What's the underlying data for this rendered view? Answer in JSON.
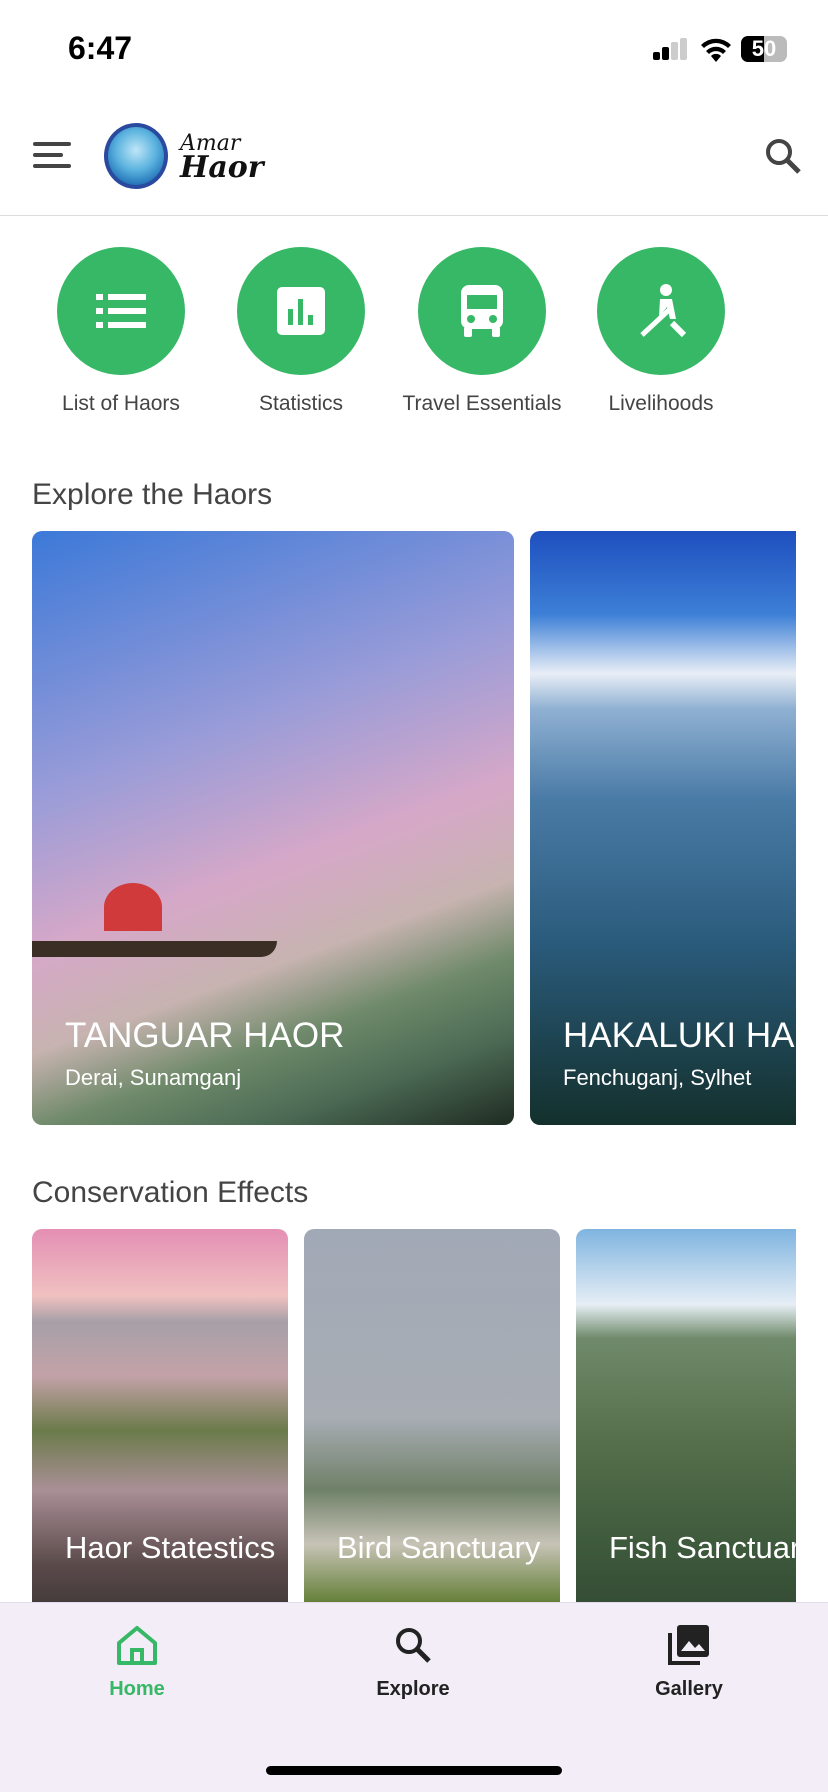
{
  "status_bar": {
    "time": "6:47",
    "battery": "50"
  },
  "header": {
    "logo_text_line1": "Amar",
    "logo_text_line2": "Haor"
  },
  "quick_actions": [
    {
      "label": "List of Haors",
      "icon": "list-icon"
    },
    {
      "label": "Statistics",
      "icon": "bar-chart-icon"
    },
    {
      "label": "Travel Essentials",
      "icon": "bus-icon"
    },
    {
      "label": "Livelihoods",
      "icon": "rowing-icon"
    }
  ],
  "explore": {
    "title": "Explore the Haors",
    "cards": [
      {
        "title": "TANGUAR HAOR",
        "subtitle": "Derai, Sunamganj"
      },
      {
        "title": "HAKALUKI HAOR",
        "subtitle": "Fenchuganj, Sylhet"
      }
    ]
  },
  "conservation": {
    "title": "Conservation Effects",
    "cards": [
      {
        "title": "Haor Statestics"
      },
      {
        "title": "Bird Sanctuary"
      },
      {
        "title": "Fish Sanctuary"
      }
    ]
  },
  "bottom_nav": {
    "items": [
      {
        "label": "Home",
        "active": true
      },
      {
        "label": "Explore",
        "active": false
      },
      {
        "label": "Gallery",
        "active": false
      }
    ]
  },
  "colors": {
    "accent": "#37b866",
    "nav_bg": "#f2edf7"
  }
}
